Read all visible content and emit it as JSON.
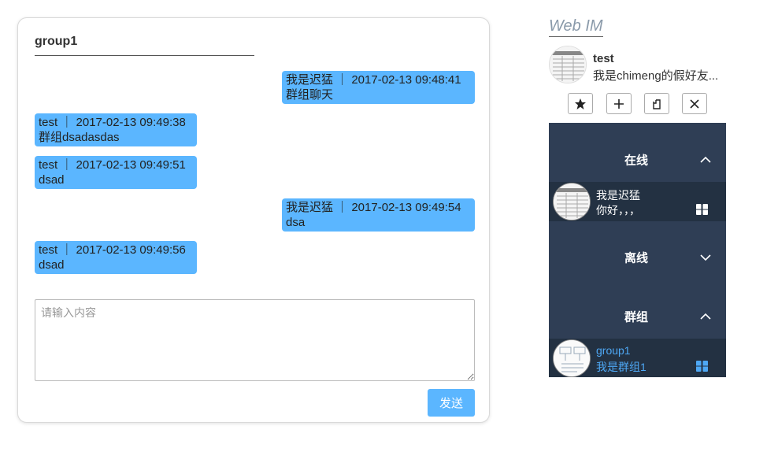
{
  "chat": {
    "title": "group1",
    "messages": [
      {
        "header": "我是迟猛 ｜ 2017-02-13 09:48:41",
        "text": "群组聊天",
        "side": "right"
      },
      {
        "header": "test ｜ 2017-02-13 09:49:38",
        "text": "群组dsadasdas",
        "side": "left"
      },
      {
        "header": "test ｜ 2017-02-13 09:49:51",
        "text": "dsad",
        "side": "left"
      },
      {
        "header": "我是迟猛 ｜ 2017-02-13 09:49:54",
        "text": "dsa",
        "side": "right"
      },
      {
        "header": "test ｜ 2017-02-13 09:49:56",
        "text": "dsad",
        "side": "left"
      }
    ],
    "input_placeholder": "请输入内容",
    "send_label": "发送"
  },
  "app": {
    "title": "Web IM"
  },
  "me": {
    "name": "test",
    "signature": "我是chimeng的假好友..."
  },
  "toolbar": {
    "icons": [
      "star-icon",
      "plus-icon",
      "copy-icon",
      "close-icon"
    ]
  },
  "sections": {
    "online": {
      "label": "在线",
      "contact": {
        "name": "我是迟猛",
        "sub": "你好，，，"
      }
    },
    "offline": {
      "label": "离线"
    },
    "groups": {
      "label": "群组",
      "contact": {
        "name": "group1",
        "sub": "我是群组1"
      }
    }
  },
  "colors": {
    "bubble": "#5bb6ff",
    "panel_bg": "#2f3e55",
    "contact_bg": "#233142",
    "group_text": "#4ea8f5"
  }
}
